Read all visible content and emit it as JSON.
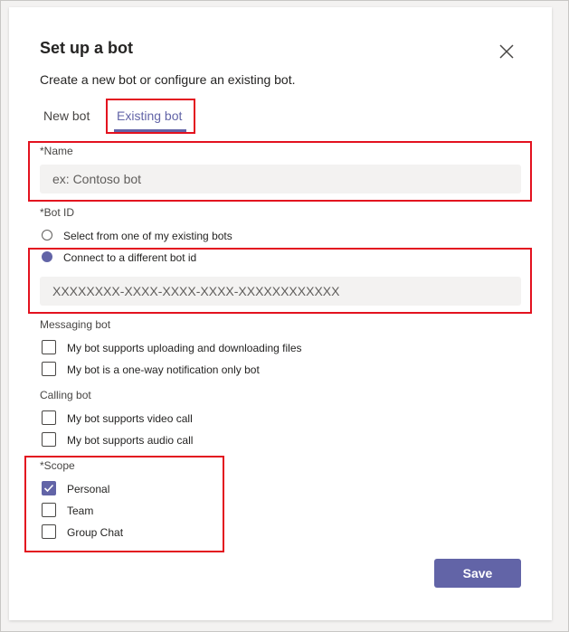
{
  "dialog": {
    "title": "Set up a bot",
    "subtitle": "Create a new bot or configure an existing bot.",
    "close_icon": "close-icon"
  },
  "tabs": [
    {
      "label": "New bot",
      "selected": false
    },
    {
      "label": "Existing bot",
      "selected": true
    }
  ],
  "name_field": {
    "label": "*Name",
    "placeholder": "ex: Contoso bot",
    "value": ""
  },
  "bot_id": {
    "label": "*Bot ID",
    "options": [
      {
        "label": "Select from one of my existing bots",
        "selected": false
      },
      {
        "label": "Connect to a different bot id",
        "selected": true
      }
    ],
    "placeholder": "XXXXXXXX-XXXX-XXXX-XXXX-XXXXXXXXXXXX",
    "value": ""
  },
  "messaging_bot": {
    "label": "Messaging bot",
    "options": [
      {
        "label": "My bot supports uploading and downloading files",
        "checked": false
      },
      {
        "label": "My bot is a one-way notification only bot",
        "checked": false
      }
    ]
  },
  "calling_bot": {
    "label": "Calling bot",
    "options": [
      {
        "label": "My bot supports video call",
        "checked": false
      },
      {
        "label": "My bot supports audio call",
        "checked": false
      }
    ]
  },
  "scope": {
    "label": "*Scope",
    "options": [
      {
        "label": "Personal",
        "checked": true
      },
      {
        "label": "Team",
        "checked": false
      },
      {
        "label": "Group Chat",
        "checked": false
      }
    ]
  },
  "footer": {
    "save_label": "Save"
  },
  "colors": {
    "accent": "#6264a7",
    "highlight": "#e3121f",
    "field_bg": "#f3f2f1"
  }
}
